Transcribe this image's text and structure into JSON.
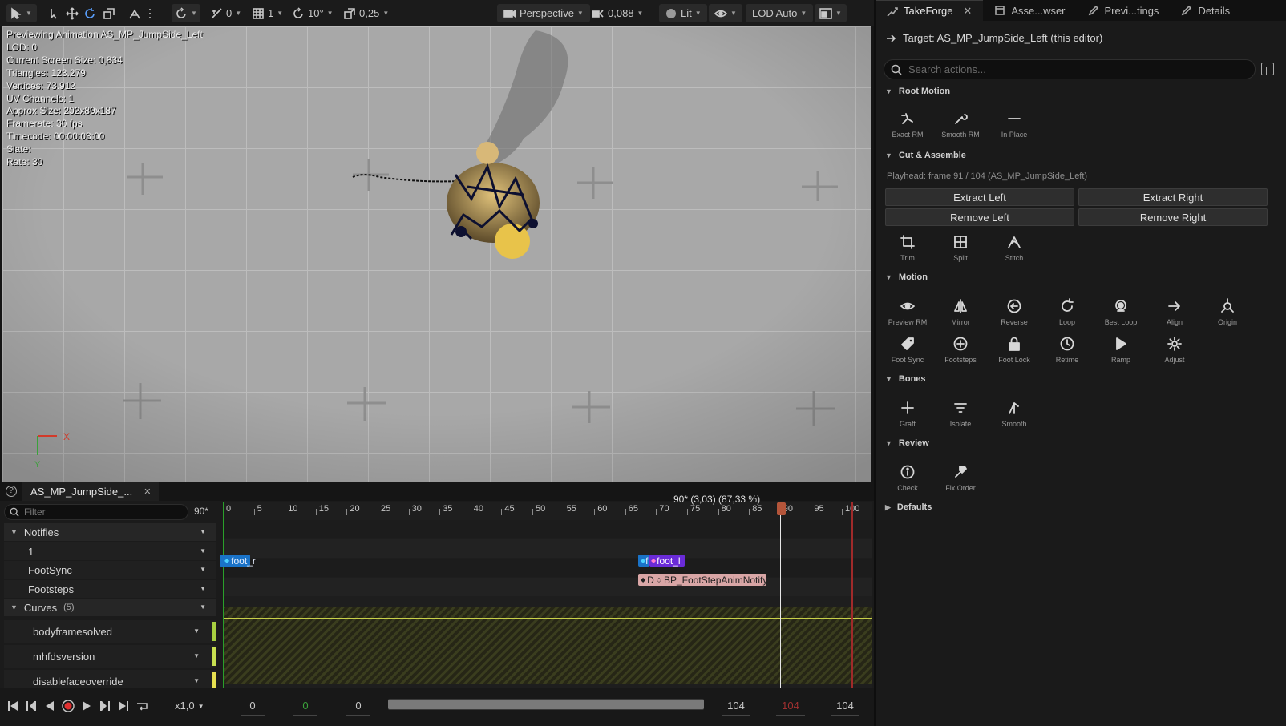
{
  "toolbar": {
    "grid_snap": "0",
    "grid_size": "1",
    "rotation_snap": "10°",
    "scale_snap": "0,25",
    "view_mode": "Perspective",
    "camera_speed": "0,088",
    "lighting": "Lit",
    "lod": "LOD Auto"
  },
  "viewport": {
    "stats": [
      "Previewing Animation AS_MP_JumpSide_Left",
      "LOD: 0",
      "Current Screen Size: 0,834",
      "Triangles: 123.279",
      "Vertices: 73.912",
      "UV Channels: 1",
      "Approx Size: 202x89x187",
      "Framerate: 30 fps",
      "Timecode: 00:00:03:00",
      "Slate:",
      "Rate: 30"
    ],
    "axis_x": "X",
    "axis_y": "Y"
  },
  "right_panel": {
    "tabs": [
      "TakeForge",
      "Asse...wser",
      "Previ...tings",
      "Details"
    ],
    "target": "Target: AS_MP_JumpSide_Left (this editor)",
    "search_placeholder": "Search actions...",
    "sections": {
      "root_motion": {
        "title": "Root Motion",
        "actions": [
          "Exact RM",
          "Smooth RM",
          "In Place"
        ]
      },
      "cut_assemble": {
        "title": "Cut & Assemble",
        "playhead": "Playhead: frame 91 / 104  (AS_MP_JumpSide_Left)",
        "buttons": [
          "Extract Left",
          "Extract Right",
          "Remove Left",
          "Remove Right"
        ],
        "actions": [
          "Trim",
          "Split",
          "Stitch"
        ]
      },
      "motion": {
        "title": "Motion",
        "actions": [
          "Preview RM",
          "Mirror",
          "Reverse",
          "Loop",
          "Best Loop",
          "Align",
          "Origin",
          "Foot Sync",
          "Footsteps",
          "Foot Lock",
          "Retime",
          "Ramp",
          "Adjust"
        ]
      },
      "bones": {
        "title": "Bones",
        "actions": [
          "Graft",
          "Isolate",
          "Smooth"
        ]
      },
      "review": {
        "title": "Review",
        "actions": [
          "Check",
          "Fix Order"
        ]
      },
      "defaults": {
        "title": "Defaults"
      }
    }
  },
  "sequencer": {
    "tab_label": "AS_MP_JumpSide_...",
    "filter_placeholder": "Filter",
    "frame_field": "90*",
    "playhead_label": "90* (3,03) (87,33 %)",
    "ruler": [
      "0",
      "5",
      "10",
      "15",
      "20",
      "25",
      "30",
      "35",
      "40",
      "45",
      "50",
      "55",
      "60",
      "65",
      "70",
      "75",
      "80",
      "85",
      "90",
      "95",
      "100"
    ],
    "tracks": {
      "notifies": "Notifies",
      "track1": "1",
      "footsync": "FootSync",
      "footsteps": "Footsteps",
      "curves": "Curves",
      "curves_count": "(5)",
      "curve_items": [
        "bodyframesolved",
        "mhfdsversion",
        "disablefaceoverride"
      ]
    },
    "notifies": {
      "foot_r": "foot_r",
      "foot_l_short": "f",
      "foot_l": "foot_l",
      "bp_short": "D",
      "bp": "BP_FootStepAnimNotify"
    },
    "transport": {
      "speed": "x1,0",
      "range_start": "0",
      "view_start_green": "0",
      "view_start": "0",
      "range_end": "104",
      "view_end_red": "104",
      "view_end": "104"
    },
    "playhead_frame": 90,
    "total_frames": 104
  },
  "colors": {
    "notify_blue": "#1a73c8",
    "notify_purple": "#6a2bd8",
    "notify_pink": "#d9a6a6",
    "curve_yellow": "#c8d04a",
    "playhead": "#b4553a"
  }
}
